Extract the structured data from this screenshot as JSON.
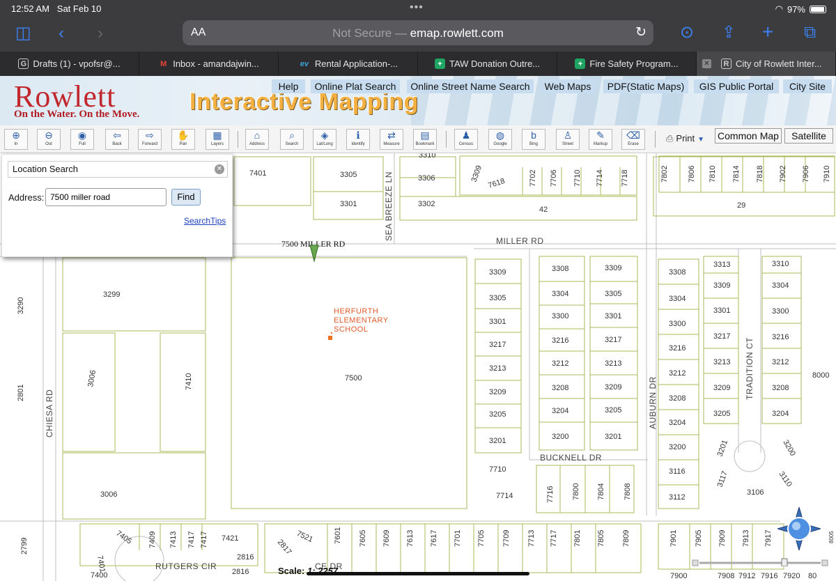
{
  "status_bar": {
    "time": "12:52 AM",
    "date": "Sat Feb 10",
    "battery": "97%"
  },
  "safari": {
    "address_prefix": "Not Secure —",
    "address_domain": "emap.rowlett.com",
    "text_size_label": "AA",
    "tabs": [
      {
        "label": "Drafts (1) - vpofsr@...",
        "favicon": "G"
      },
      {
        "label": "Inbox - amandajwin...",
        "favicon": "M"
      },
      {
        "label": "Rental Application-...",
        "favicon": "ev"
      },
      {
        "label": "TAW Donation Outre...",
        "favicon": "+"
      },
      {
        "label": "Fire Safety Program...",
        "favicon": "+"
      },
      {
        "label": "City of Rowlett Inter...",
        "favicon": "R"
      }
    ]
  },
  "header": {
    "logo": "Rowlett",
    "tagline": "On the Water. On the Move.",
    "title": "Interactive Mapping",
    "links": [
      "Help",
      "Online Plat Search",
      "Online Street Name Search",
      "Web Maps",
      "PDF(Static Maps)",
      "GIS Public Portal",
      "City Site"
    ]
  },
  "tools": [
    {
      "label": "In",
      "icon": "zoom-in-icon",
      "glyph": "⊕"
    },
    {
      "label": "Out",
      "icon": "zoom-out-icon",
      "glyph": "⊖"
    },
    {
      "label": "Full",
      "icon": "full-extent-icon",
      "glyph": "◉"
    },
    {
      "label": "Back",
      "icon": "back-arrow-icon",
      "glyph": "⇦"
    },
    {
      "label": "Forward",
      "icon": "forward-arrow-icon",
      "glyph": "⇨"
    },
    {
      "label": "Pan",
      "icon": "hand-icon",
      "glyph": "✋"
    },
    {
      "label": "Layers",
      "icon": "layers-icon",
      "glyph": "▦"
    },
    {
      "label": "Address",
      "icon": "address-icon",
      "glyph": "⌂"
    },
    {
      "label": "Search",
      "icon": "search-icon",
      "glyph": "⌕"
    },
    {
      "label": "Lat/Long",
      "icon": "lat-long-icon",
      "glyph": "◈"
    },
    {
      "label": "Identify",
      "icon": "info-icon",
      "glyph": "ℹ"
    },
    {
      "label": "Measure",
      "icon": "measure-icon",
      "glyph": "⇄"
    },
    {
      "label": "Bookmark",
      "icon": "bookmark-icon",
      "glyph": "▤"
    },
    {
      "label": "Census",
      "icon": "census-icon",
      "glyph": "♟"
    },
    {
      "label": "Google",
      "icon": "google-icon",
      "glyph": "◍"
    },
    {
      "label": "Bing",
      "icon": "bing-icon",
      "glyph": "b"
    },
    {
      "label": "Street",
      "icon": "street-view-icon",
      "glyph": "♙"
    },
    {
      "label": "Markup",
      "icon": "markup-icon",
      "glyph": "✎"
    },
    {
      "label": "Erase",
      "icon": "erase-icon",
      "glyph": "⌫"
    }
  ],
  "print_label": "Print",
  "basemaps": [
    "Common Map",
    "Satellite"
  ],
  "location_search": {
    "title": "Location Search",
    "address_label": "Address:",
    "address_value": "7500 miller road",
    "find_label": "Find",
    "tips_label": "SearchTips"
  },
  "map": {
    "pin_label": "7500 MILLER RD",
    "school": [
      "HERFURTH",
      "ELEMENTARY",
      "SCHOOL"
    ],
    "roads": [
      "MILLER RD",
      "SEA BREEZE LN",
      "CHIESA RD",
      "AUBURN DR",
      "TRADITION CT",
      "BUCKNELL DR",
      "RUTGERS CIR",
      "CE DR"
    ]
  },
  "scale": {
    "label": "Scale:",
    "value": "1: 2257"
  }
}
